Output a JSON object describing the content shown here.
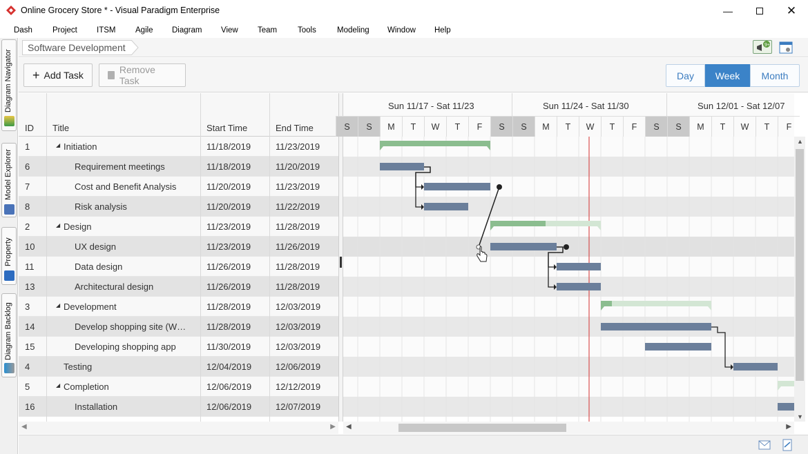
{
  "window": {
    "title": "Online Grocery Store * - Visual Paradigm Enterprise"
  },
  "menu": [
    "Dash",
    "Project",
    "ITSM",
    "Agile",
    "Diagram",
    "View",
    "Team",
    "Tools",
    "Modeling",
    "Window",
    "Help"
  ],
  "rail_tabs": [
    "Diagram Navigator",
    "Model Explorer",
    "Property",
    "Diagram Backlog"
  ],
  "breadcrumb": "Software Development",
  "toolbar": {
    "add_task": "Add Task",
    "remove_task": "Remove Task"
  },
  "view_modes": {
    "day": "Day",
    "week": "Week",
    "month": "Month",
    "active": "week"
  },
  "columns": {
    "id": "ID",
    "title": "Title",
    "start": "Start Time",
    "end": "End Time"
  },
  "tasks": [
    {
      "id": "1",
      "title": "Initiation",
      "start": "11/18/2019",
      "end": "11/23/2019",
      "group": true,
      "indent": 0
    },
    {
      "id": "6",
      "title": "Requirement meetings",
      "start": "11/18/2019",
      "end": "11/20/2019",
      "group": false,
      "indent": 1
    },
    {
      "id": "7",
      "title": "Cost and Benefit Analysis",
      "start": "11/20/2019",
      "end": "11/23/2019",
      "group": false,
      "indent": 1
    },
    {
      "id": "8",
      "title": "Risk analysis",
      "start": "11/20/2019",
      "end": "11/22/2019",
      "group": false,
      "indent": 1
    },
    {
      "id": "2",
      "title": "Design",
      "start": "11/23/2019",
      "end": "11/28/2019",
      "group": true,
      "indent": 0
    },
    {
      "id": "10",
      "title": "UX design",
      "start": "11/23/2019",
      "end": "11/26/2019",
      "group": false,
      "indent": 1
    },
    {
      "id": "11",
      "title": "Data design",
      "start": "11/26/2019",
      "end": "11/28/2019",
      "group": false,
      "indent": 1
    },
    {
      "id": "13",
      "title": "Architectural design",
      "start": "11/26/2019",
      "end": "11/28/2019",
      "group": false,
      "indent": 1
    },
    {
      "id": "3",
      "title": "Development",
      "start": "11/28/2019",
      "end": "12/03/2019",
      "group": true,
      "indent": 0
    },
    {
      "id": "14",
      "title": "Develop shopping site (W…",
      "start": "11/28/2019",
      "end": "12/03/2019",
      "group": false,
      "indent": 1
    },
    {
      "id": "15",
      "title": "Developing shopping app",
      "start": "11/30/2019",
      "end": "12/03/2019",
      "group": false,
      "indent": 1
    },
    {
      "id": "4",
      "title": "Testing",
      "start": "12/04/2019",
      "end": "12/06/2019",
      "group": false,
      "indent": 0,
      "plain": true
    },
    {
      "id": "5",
      "title": "Completion",
      "start": "12/06/2019",
      "end": "12/12/2019",
      "group": true,
      "indent": 0
    },
    {
      "id": "16",
      "title": "Installation",
      "start": "12/06/2019",
      "end": "12/07/2019",
      "group": false,
      "indent": 1
    }
  ],
  "timeline": {
    "weeks": [
      "Sun 11/17 - Sat 11/23",
      "Sun 11/24 - Sat 11/30",
      "Sun 12/01 - Sat 12/07"
    ],
    "day_letters": [
      "S",
      "S",
      "M",
      "T",
      "W",
      "T",
      "F",
      "S",
      "S",
      "M",
      "T",
      "W",
      "T",
      "F",
      "S",
      "S",
      "M",
      "T",
      "W",
      "T",
      "F"
    ],
    "first_day": "11/16/2019",
    "today": "11/27/2019"
  },
  "bars": [
    {
      "row": 0,
      "start": 2,
      "end": 7,
      "kind": "group",
      "progress": 1.0
    },
    {
      "row": 1,
      "start": 2,
      "end": 4,
      "kind": "task"
    },
    {
      "row": 2,
      "start": 4,
      "end": 7,
      "kind": "task"
    },
    {
      "row": 3,
      "start": 4,
      "end": 6,
      "kind": "task"
    },
    {
      "row": 4,
      "start": 7,
      "end": 12,
      "kind": "group",
      "progress": 0.5
    },
    {
      "row": 5,
      "start": 7,
      "end": 10,
      "kind": "task"
    },
    {
      "row": 6,
      "start": 10,
      "end": 12,
      "kind": "task"
    },
    {
      "row": 7,
      "start": 10,
      "end": 12,
      "kind": "task"
    },
    {
      "row": 8,
      "start": 12,
      "end": 17,
      "kind": "group",
      "progress": 0.1
    },
    {
      "row": 9,
      "start": 12,
      "end": 17,
      "kind": "task"
    },
    {
      "row": 10,
      "start": 14,
      "end": 17,
      "kind": "task"
    },
    {
      "row": 11,
      "start": 18,
      "end": 20,
      "kind": "task"
    },
    {
      "row": 12,
      "start": 20,
      "end": 26,
      "kind": "group",
      "progress": 0.0
    },
    {
      "row": 13,
      "start": 20,
      "end": 21,
      "kind": "task"
    }
  ],
  "links": [
    {
      "from": 1,
      "to": 2
    },
    {
      "from": 1,
      "to": 3
    },
    {
      "from": 5,
      "to": 6
    },
    {
      "from": 5,
      "to": 7
    },
    {
      "from": 9,
      "to": 11
    }
  ],
  "colors": {
    "task": "#6b7f9b",
    "group": "#8bbd8f",
    "group_light": "#d3e6d4",
    "today": "#d32f2f",
    "accent": "#3b83c8",
    "weekend": "#c9c9c9"
  }
}
